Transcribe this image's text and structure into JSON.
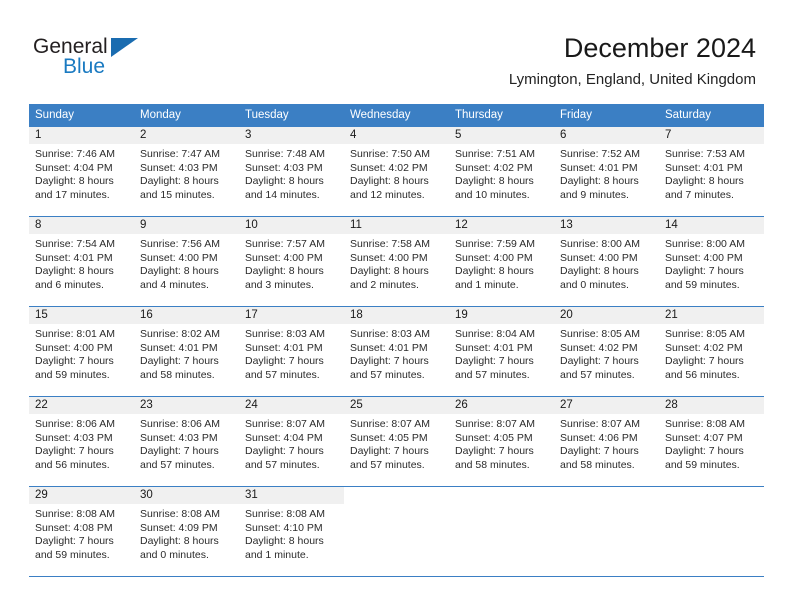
{
  "brand": {
    "word_one": "General",
    "word_two": "Blue",
    "triangle_icon": "triangle-icon",
    "colors": {
      "general": "#231f20",
      "blue": "#1a7ac1",
      "triangle": "#1a6cb0"
    }
  },
  "header": {
    "title": "December 2024",
    "subtitle": "Lymington, England, United Kingdom"
  },
  "theme": {
    "header_bg": "#3b7fc4",
    "header_text": "#ffffff",
    "daynum_band_bg": "#f0f0f0",
    "row_separator": "#3b7fc4",
    "body_text": "#2b2b2b"
  },
  "weekday_headers": [
    "Sunday",
    "Monday",
    "Tuesday",
    "Wednesday",
    "Thursday",
    "Friday",
    "Saturday"
  ],
  "labels": {
    "sunrise_prefix": "Sunrise:",
    "sunset_prefix": "Sunset:",
    "daylight_prefix": "Daylight:"
  },
  "weeks": [
    [
      {
        "day": "1",
        "sunrise": "Sunrise: 7:46 AM",
        "sunset": "Sunset: 4:04 PM",
        "daylight_line1": "Daylight: 8 hours",
        "daylight_line2": "and 17 minutes."
      },
      {
        "day": "2",
        "sunrise": "Sunrise: 7:47 AM",
        "sunset": "Sunset: 4:03 PM",
        "daylight_line1": "Daylight: 8 hours",
        "daylight_line2": "and 15 minutes."
      },
      {
        "day": "3",
        "sunrise": "Sunrise: 7:48 AM",
        "sunset": "Sunset: 4:03 PM",
        "daylight_line1": "Daylight: 8 hours",
        "daylight_line2": "and 14 minutes."
      },
      {
        "day": "4",
        "sunrise": "Sunrise: 7:50 AM",
        "sunset": "Sunset: 4:02 PM",
        "daylight_line1": "Daylight: 8 hours",
        "daylight_line2": "and 12 minutes."
      },
      {
        "day": "5",
        "sunrise": "Sunrise: 7:51 AM",
        "sunset": "Sunset: 4:02 PM",
        "daylight_line1": "Daylight: 8 hours",
        "daylight_line2": "and 10 minutes."
      },
      {
        "day": "6",
        "sunrise": "Sunrise: 7:52 AM",
        "sunset": "Sunset: 4:01 PM",
        "daylight_line1": "Daylight: 8 hours",
        "daylight_line2": "and 9 minutes."
      },
      {
        "day": "7",
        "sunrise": "Sunrise: 7:53 AM",
        "sunset": "Sunset: 4:01 PM",
        "daylight_line1": "Daylight: 8 hours",
        "daylight_line2": "and 7 minutes."
      }
    ],
    [
      {
        "day": "8",
        "sunrise": "Sunrise: 7:54 AM",
        "sunset": "Sunset: 4:01 PM",
        "daylight_line1": "Daylight: 8 hours",
        "daylight_line2": "and 6 minutes."
      },
      {
        "day": "9",
        "sunrise": "Sunrise: 7:56 AM",
        "sunset": "Sunset: 4:00 PM",
        "daylight_line1": "Daylight: 8 hours",
        "daylight_line2": "and 4 minutes."
      },
      {
        "day": "10",
        "sunrise": "Sunrise: 7:57 AM",
        "sunset": "Sunset: 4:00 PM",
        "daylight_line1": "Daylight: 8 hours",
        "daylight_line2": "and 3 minutes."
      },
      {
        "day": "11",
        "sunrise": "Sunrise: 7:58 AM",
        "sunset": "Sunset: 4:00 PM",
        "daylight_line1": "Daylight: 8 hours",
        "daylight_line2": "and 2 minutes."
      },
      {
        "day": "12",
        "sunrise": "Sunrise: 7:59 AM",
        "sunset": "Sunset: 4:00 PM",
        "daylight_line1": "Daylight: 8 hours",
        "daylight_line2": "and 1 minute."
      },
      {
        "day": "13",
        "sunrise": "Sunrise: 8:00 AM",
        "sunset": "Sunset: 4:00 PM",
        "daylight_line1": "Daylight: 8 hours",
        "daylight_line2": "and 0 minutes."
      },
      {
        "day": "14",
        "sunrise": "Sunrise: 8:00 AM",
        "sunset": "Sunset: 4:00 PM",
        "daylight_line1": "Daylight: 7 hours",
        "daylight_line2": "and 59 minutes."
      }
    ],
    [
      {
        "day": "15",
        "sunrise": "Sunrise: 8:01 AM",
        "sunset": "Sunset: 4:00 PM",
        "daylight_line1": "Daylight: 7 hours",
        "daylight_line2": "and 59 minutes."
      },
      {
        "day": "16",
        "sunrise": "Sunrise: 8:02 AM",
        "sunset": "Sunset: 4:01 PM",
        "daylight_line1": "Daylight: 7 hours",
        "daylight_line2": "and 58 minutes."
      },
      {
        "day": "17",
        "sunrise": "Sunrise: 8:03 AM",
        "sunset": "Sunset: 4:01 PM",
        "daylight_line1": "Daylight: 7 hours",
        "daylight_line2": "and 57 minutes."
      },
      {
        "day": "18",
        "sunrise": "Sunrise: 8:03 AM",
        "sunset": "Sunset: 4:01 PM",
        "daylight_line1": "Daylight: 7 hours",
        "daylight_line2": "and 57 minutes."
      },
      {
        "day": "19",
        "sunrise": "Sunrise: 8:04 AM",
        "sunset": "Sunset: 4:01 PM",
        "daylight_line1": "Daylight: 7 hours",
        "daylight_line2": "and 57 minutes."
      },
      {
        "day": "20",
        "sunrise": "Sunrise: 8:05 AM",
        "sunset": "Sunset: 4:02 PM",
        "daylight_line1": "Daylight: 7 hours",
        "daylight_line2": "and 57 minutes."
      },
      {
        "day": "21",
        "sunrise": "Sunrise: 8:05 AM",
        "sunset": "Sunset: 4:02 PM",
        "daylight_line1": "Daylight: 7 hours",
        "daylight_line2": "and 56 minutes."
      }
    ],
    [
      {
        "day": "22",
        "sunrise": "Sunrise: 8:06 AM",
        "sunset": "Sunset: 4:03 PM",
        "daylight_line1": "Daylight: 7 hours",
        "daylight_line2": "and 56 minutes."
      },
      {
        "day": "23",
        "sunrise": "Sunrise: 8:06 AM",
        "sunset": "Sunset: 4:03 PM",
        "daylight_line1": "Daylight: 7 hours",
        "daylight_line2": "and 57 minutes."
      },
      {
        "day": "24",
        "sunrise": "Sunrise: 8:07 AM",
        "sunset": "Sunset: 4:04 PM",
        "daylight_line1": "Daylight: 7 hours",
        "daylight_line2": "and 57 minutes."
      },
      {
        "day": "25",
        "sunrise": "Sunrise: 8:07 AM",
        "sunset": "Sunset: 4:05 PM",
        "daylight_line1": "Daylight: 7 hours",
        "daylight_line2": "and 57 minutes."
      },
      {
        "day": "26",
        "sunrise": "Sunrise: 8:07 AM",
        "sunset": "Sunset: 4:05 PM",
        "daylight_line1": "Daylight: 7 hours",
        "daylight_line2": "and 58 minutes."
      },
      {
        "day": "27",
        "sunrise": "Sunrise: 8:07 AM",
        "sunset": "Sunset: 4:06 PM",
        "daylight_line1": "Daylight: 7 hours",
        "daylight_line2": "and 58 minutes."
      },
      {
        "day": "28",
        "sunrise": "Sunrise: 8:08 AM",
        "sunset": "Sunset: 4:07 PM",
        "daylight_line1": "Daylight: 7 hours",
        "daylight_line2": "and 59 minutes."
      }
    ],
    [
      {
        "day": "29",
        "sunrise": "Sunrise: 8:08 AM",
        "sunset": "Sunset: 4:08 PM",
        "daylight_line1": "Daylight: 7 hours",
        "daylight_line2": "and 59 minutes."
      },
      {
        "day": "30",
        "sunrise": "Sunrise: 8:08 AM",
        "sunset": "Sunset: 4:09 PM",
        "daylight_line1": "Daylight: 8 hours",
        "daylight_line2": "and 0 minutes."
      },
      {
        "day": "31",
        "sunrise": "Sunrise: 8:08 AM",
        "sunset": "Sunset: 4:10 PM",
        "daylight_line1": "Daylight: 8 hours",
        "daylight_line2": "and 1 minute."
      },
      {
        "day": "",
        "sunrise": "",
        "sunset": "",
        "daylight_line1": "",
        "daylight_line2": ""
      },
      {
        "day": "",
        "sunrise": "",
        "sunset": "",
        "daylight_line1": "",
        "daylight_line2": ""
      },
      {
        "day": "",
        "sunrise": "",
        "sunset": "",
        "daylight_line1": "",
        "daylight_line2": ""
      },
      {
        "day": "",
        "sunrise": "",
        "sunset": "",
        "daylight_line1": "",
        "daylight_line2": ""
      }
    ]
  ]
}
